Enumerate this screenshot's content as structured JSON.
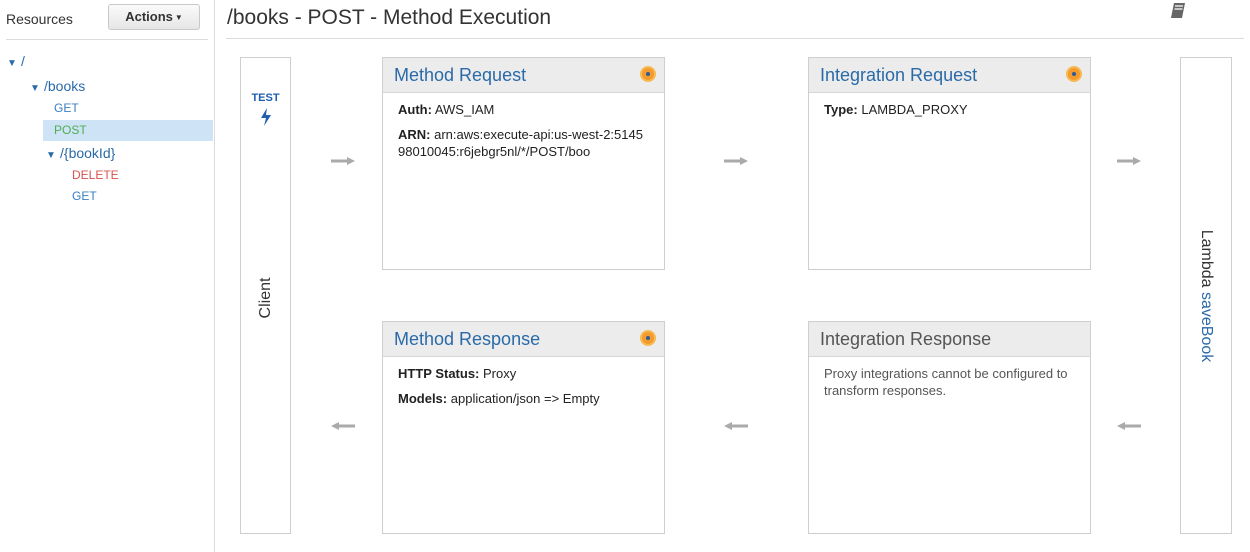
{
  "sidebar": {
    "title": "Resources",
    "actions_label": "Actions",
    "tree": {
      "root": "/",
      "books": "/books",
      "books_get": "GET",
      "books_post": "POST",
      "bookid": "/{bookId}",
      "bookid_delete": "DELETE",
      "bookid_get": "GET"
    }
  },
  "header": {
    "title": "/books - POST - Method Execution"
  },
  "client": {
    "test_label": "TEST",
    "label": "Client"
  },
  "lambda": {
    "prefix": "Lambda",
    "function_name": "saveBook"
  },
  "method_request": {
    "title": "Method Request",
    "auth_label": "Auth:",
    "auth_value": "AWS_IAM",
    "arn_label": "ARN:",
    "arn_value": "arn:aws:execute-api:us-west-2:514598010045:r6jebgr5nl/*/POST/boo"
  },
  "integration_request": {
    "title": "Integration Request",
    "type_label": "Type:",
    "type_value": "LAMBDA_PROXY"
  },
  "method_response": {
    "title": "Method Response",
    "status_label": "HTTP Status:",
    "status_value": "Proxy",
    "models_label": "Models:",
    "models_value": "application/json => Empty"
  },
  "integration_response": {
    "title": "Integration Response",
    "note": "Proxy integrations cannot be configured to transform responses."
  },
  "colors": {
    "link": "#2a6aa8",
    "badge": "#f39c2b",
    "selected_bg": "#cfe3f7"
  }
}
